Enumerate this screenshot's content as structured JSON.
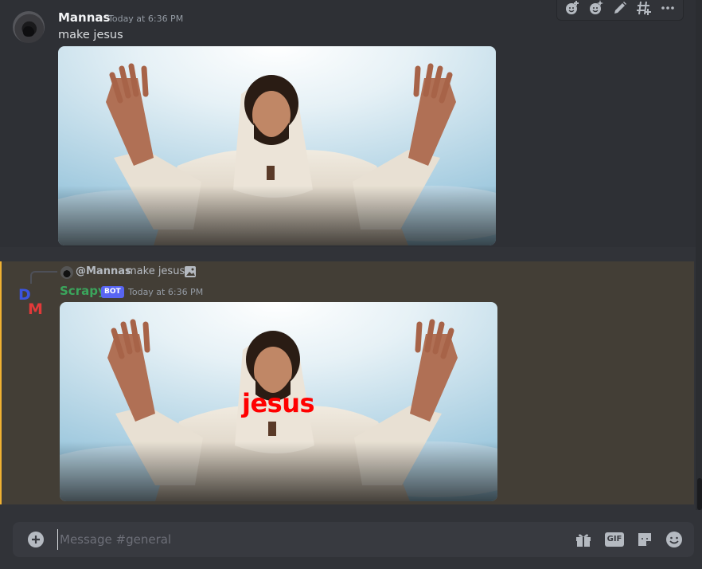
{
  "message1": {
    "author": "Mannas",
    "timestamp": "Today at 6:36 PM",
    "content": "make jesus",
    "attachment_icon": "image-attachment"
  },
  "toolbar": {
    "icons": [
      "add-reaction-icon",
      "super-reaction-icon",
      "edit-icon",
      "create-thread-icon",
      "more-icon"
    ]
  },
  "message2": {
    "reply": {
      "author": "@Mannas",
      "text": "make jesus",
      "icon": "image-icon"
    },
    "author": "Scrapy",
    "badge": "BOT",
    "timestamp": "Today at 6:36 PM",
    "image_caption": "jesus",
    "avatar_letters": [
      "D",
      "M"
    ]
  },
  "composer": {
    "placeholder": "Message #general",
    "icons": [
      "plus-icon",
      "gift-icon",
      "gif-icon",
      "sticker-icon",
      "emoji-icon"
    ],
    "gif_label": "GIF"
  },
  "colors": {
    "background": "#313338",
    "highlight": "#433e36",
    "highlight_border": "#f0b132",
    "bot_name": "#3ba55c",
    "badge": "#5865f2",
    "caption": "#ff0000"
  }
}
